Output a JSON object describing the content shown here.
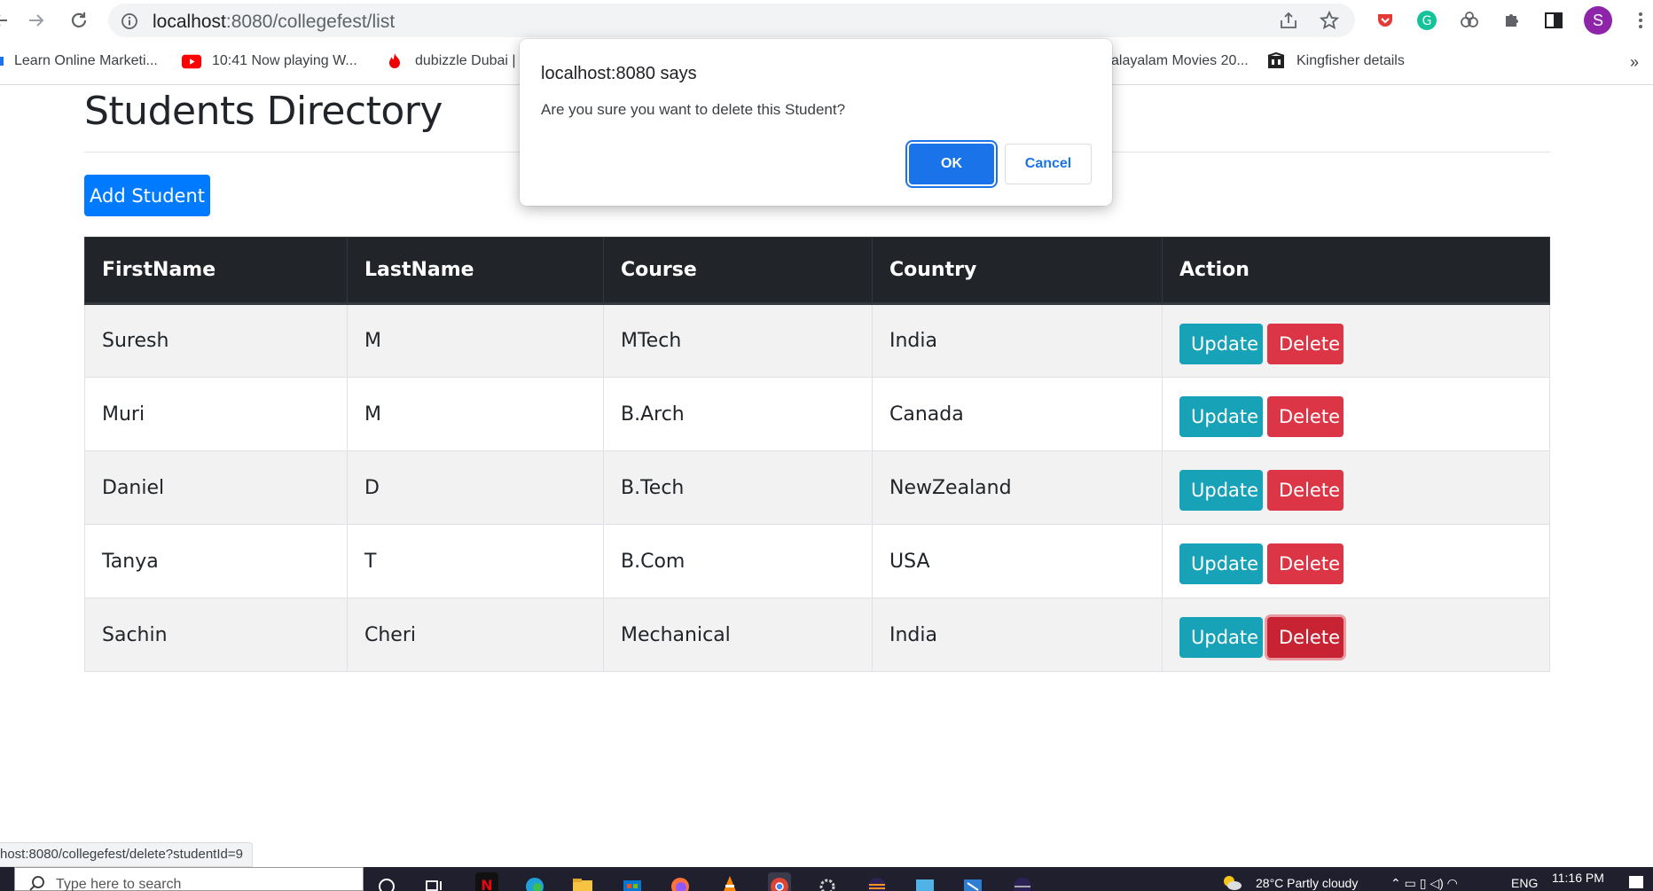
{
  "browser": {
    "url_host": "localhost",
    "url_path": ":8080/collegefest/list",
    "avatar_letter": "S",
    "bookmarks": [
      {
        "label": "Learn Online Marketi...",
        "icon": "globe-icon",
        "color": "#1a73e8"
      },
      {
        "label": "10:41 Now playing W...",
        "icon": "youtube-icon",
        "color": "#ff0000"
      },
      {
        "label": "dubizzle Dubai |",
        "icon": "flame-icon",
        "color": "#e00"
      },
      {
        "label": "alayalam Movies 20...",
        "icon": "generic-icon",
        "color": "#666"
      },
      {
        "label": "Kingfisher details",
        "icon": "kingfisher-icon",
        "color": "#222"
      }
    ]
  },
  "page": {
    "title": "Students Directory",
    "add_button": "Add Student",
    "columns": [
      "FirstName",
      "LastName",
      "Course",
      "Country",
      "Action"
    ],
    "update_label": "Update",
    "delete_label": "Delete",
    "rows": [
      {
        "first": "Suresh",
        "last": "M",
        "course": "MTech",
        "country": "India"
      },
      {
        "first": "Muri",
        "last": "M",
        "course": "B.Arch",
        "country": "Canada"
      },
      {
        "first": "Daniel",
        "last": "D",
        "course": "B.Tech",
        "country": "NewZealand"
      },
      {
        "first": "Tanya",
        "last": "T",
        "course": "B.Com",
        "country": "USA"
      },
      {
        "first": "Sachin",
        "last": "Cheri",
        "course": "Mechanical",
        "country": "India"
      }
    ]
  },
  "dialog": {
    "title": "localhost:8080 says",
    "message": "Are you sure you want to delete this Student?",
    "ok": "OK",
    "cancel": "Cancel"
  },
  "status_url": "host:8080/collegefest/delete?studentId=9",
  "taskbar": {
    "search_placeholder": "Type here to search",
    "weather": "28°C  Partly cloudy",
    "lang": "ENG",
    "time": "11:16 PM"
  }
}
